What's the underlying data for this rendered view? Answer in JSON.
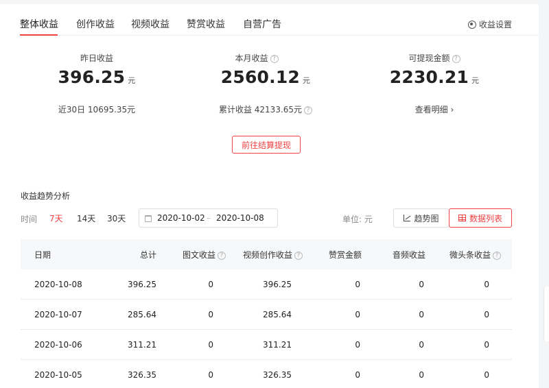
{
  "tabs": [
    {
      "label": "整体收益",
      "active": true
    },
    {
      "label": "创作收益"
    },
    {
      "label": "视频收益"
    },
    {
      "label": "赞赏收益"
    },
    {
      "label": "自营广告"
    }
  ],
  "settings_label": "收益设置",
  "stats": {
    "yesterday": {
      "label": "昨日收益",
      "value": "396.25",
      "unit": "元",
      "sub_label": "近30日",
      "sub_value": "10695.35元"
    },
    "month": {
      "label": "本月收益",
      "value": "2560.12",
      "unit": "元",
      "sub_label": "累计收益",
      "sub_value": "42133.65元"
    },
    "withdrawable": {
      "label": "可提现金额",
      "value": "2230.21",
      "unit": "元",
      "link": "查看明细"
    }
  },
  "withdraw_button": "前往结算提现",
  "trend": {
    "title": "收益趋势分析",
    "time_label": "时间",
    "ranges": [
      "7天",
      "14天",
      "30天"
    ],
    "active_range": "7天",
    "date_start": "2020-10-02",
    "date_sep": "–",
    "date_end": "2020-10-08",
    "unit_label": "单位: 元",
    "view_chart": "趋势图",
    "view_table": "数据列表"
  },
  "table": {
    "headers": [
      "日期",
      "总计",
      "图文收益",
      "视频创作收益",
      "赞赏金额",
      "音频收益",
      "微头条收益"
    ],
    "rows": [
      [
        "2020-10-08",
        "396.25",
        "0",
        "396.25",
        "0",
        "0",
        "0"
      ],
      [
        "2020-10-07",
        "285.64",
        "0",
        "285.64",
        "0",
        "0",
        "0"
      ],
      [
        "2020-10-06",
        "311.21",
        "0",
        "311.21",
        "0",
        "0",
        "0"
      ],
      [
        "2020-10-05",
        "326.35",
        "0",
        "326.35",
        "0",
        "0",
        "0"
      ]
    ]
  },
  "colors": {
    "accent": "#f04142",
    "header_bg": "#f7f8fa"
  },
  "icons": {
    "settings": "gear-icon",
    "help": "question-circle-icon",
    "chevron": "chevron-right-icon",
    "calendar": "calendar-icon",
    "chart": "line-chart-icon",
    "grid": "table-grid-icon"
  }
}
